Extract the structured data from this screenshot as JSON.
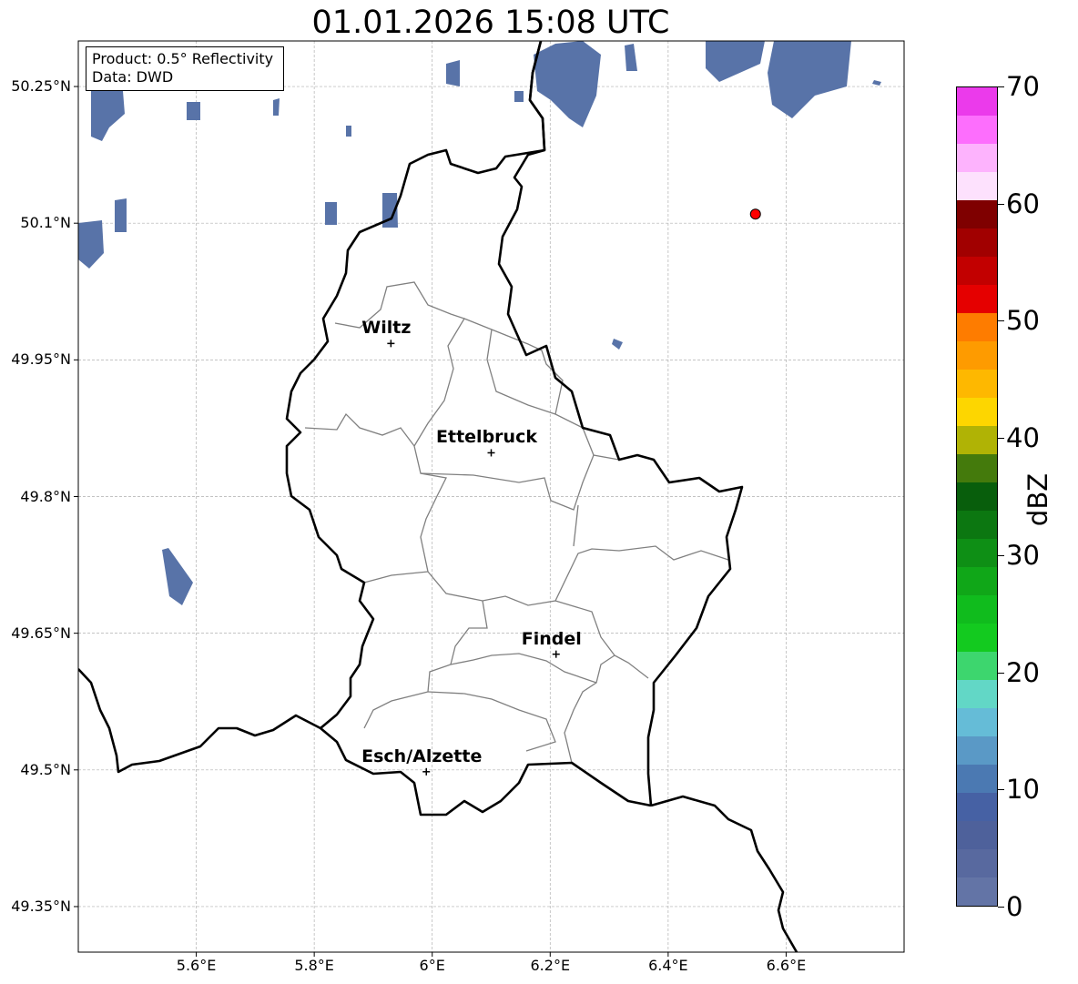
{
  "title": "01.01.2026 15:08 UTC",
  "info": {
    "product": "Product: 0.5° Reflectivity",
    "data": "Data: DWD"
  },
  "lat_ticks": [
    {
      "value": 50.25,
      "label": "50.25°N"
    },
    {
      "value": 50.1,
      "label": "50.1°N"
    },
    {
      "value": 49.95,
      "label": "49.95°N"
    },
    {
      "value": 49.8,
      "label": "49.8°N"
    },
    {
      "value": 49.65,
      "label": "49.65°N"
    },
    {
      "value": 49.5,
      "label": "49.5°N"
    },
    {
      "value": 49.35,
      "label": "49.35°N"
    }
  ],
  "lon_ticks": [
    {
      "value": 5.6,
      "label": "5.6°E"
    },
    {
      "value": 5.8,
      "label": "5.8°E"
    },
    {
      "value": 6.0,
      "label": "6°E"
    },
    {
      "value": 6.2,
      "label": "6.2°E"
    },
    {
      "value": 6.4,
      "label": "6.4°E"
    },
    {
      "value": 6.6,
      "label": "6.6°E"
    }
  ],
  "map_extent": {
    "lon_min": 5.4,
    "lon_max": 6.8,
    "lat_min": 49.3,
    "lat_max": 50.3
  },
  "cities": [
    {
      "name": "Wiltz",
      "lon": 5.93,
      "lat": 49.968
    },
    {
      "name": "Ettelbruck",
      "lon": 6.1,
      "lat": 49.848
    },
    {
      "name": "Findel",
      "lon": 6.21,
      "lat": 49.627
    },
    {
      "name": "Esch/Alzette",
      "lon": 5.99,
      "lat": 49.498
    }
  ],
  "radar_site": {
    "lon": 6.548,
    "lat": 50.11,
    "color": "#ff0000"
  },
  "colorbar": {
    "unit": "dBZ",
    "min": 0,
    "max": 70,
    "ticks": [
      {
        "value": 0,
        "label": "0"
      },
      {
        "value": 10,
        "label": "10"
      },
      {
        "value": 20,
        "label": "20"
      },
      {
        "value": 30,
        "label": "30"
      },
      {
        "value": 40,
        "label": "40"
      },
      {
        "value": 50,
        "label": "50"
      },
      {
        "value": 60,
        "label": "60"
      },
      {
        "value": 70,
        "label": "70"
      }
    ],
    "colors": [
      "#6374a6",
      "#58699f",
      "#4e619b",
      "#4661a4",
      "#4b79b2",
      "#5a99c6",
      "#65bcd7",
      "#62d7c6",
      "#3dd66e",
      "#13ca1f",
      "#10bc1d",
      "#10a718",
      "#0e8f15",
      "#0c7711",
      "#085e0c",
      "#447a0c",
      "#b0b305",
      "#fdd600",
      "#feb800",
      "#fe9b00",
      "#fe7c00",
      "#e50000",
      "#c20000",
      "#a10000",
      "#7f0000",
      "#fde1fd",
      "#fdb3fd",
      "#fd6efd",
      "#eb3aeb"
    ]
  }
}
